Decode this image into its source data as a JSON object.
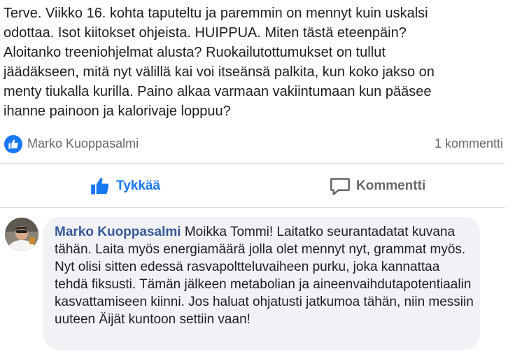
{
  "post": {
    "text": "Terve. Viikko 16. kohta taputeltu ja paremmin on mennyt kuin uskalsi\nodottaa. Isot kiitokset ohjeista. HUIPPUA. Miten tästä eteenpäin?\nAloitanko treeniohjelmat alusta? Ruokailutottumukset on tullut\njäädäkseen, mitä nyt välillä kai voi itseänsä palkita, kun koko jakso on\nmenty tiukalla kurilla. Paino alkaa varmaan vakiintumaan kun pääsee\nihanne painoon ja kalorivaje loppuu?"
  },
  "reactions": {
    "icon": "thumbs-up-icon",
    "reactor_name": "Marko Kuoppasalmi",
    "comment_count": "1 kommentti"
  },
  "actions": {
    "like_label": "Tykkää",
    "comment_label": "Kommentti"
  },
  "comment": {
    "author": "Marko Kuoppasalmi",
    "text": "Moikka Tommi! Laitatko seurantadatat kuvana tähän. Laita myös energiamäärä jolla olet mennyt nyt, grammat myös. Nyt olisi sitten edessä rasvapoltteluvaiheen purku, joka kannattaa tehdä fiksusti. Tämän jälkeen metabolian ja aineenvaihdutapotentiaalin kasvattamiseen kiinni. Jos haluat ohjatusti jatkumoa tähän, niin messiin uuteen Äijät kuntoon settiin vaan!"
  },
  "colors": {
    "accent": "#1877f2",
    "author_link": "#385898",
    "muted": "#65676b",
    "bubble": "#f0f2f5"
  }
}
